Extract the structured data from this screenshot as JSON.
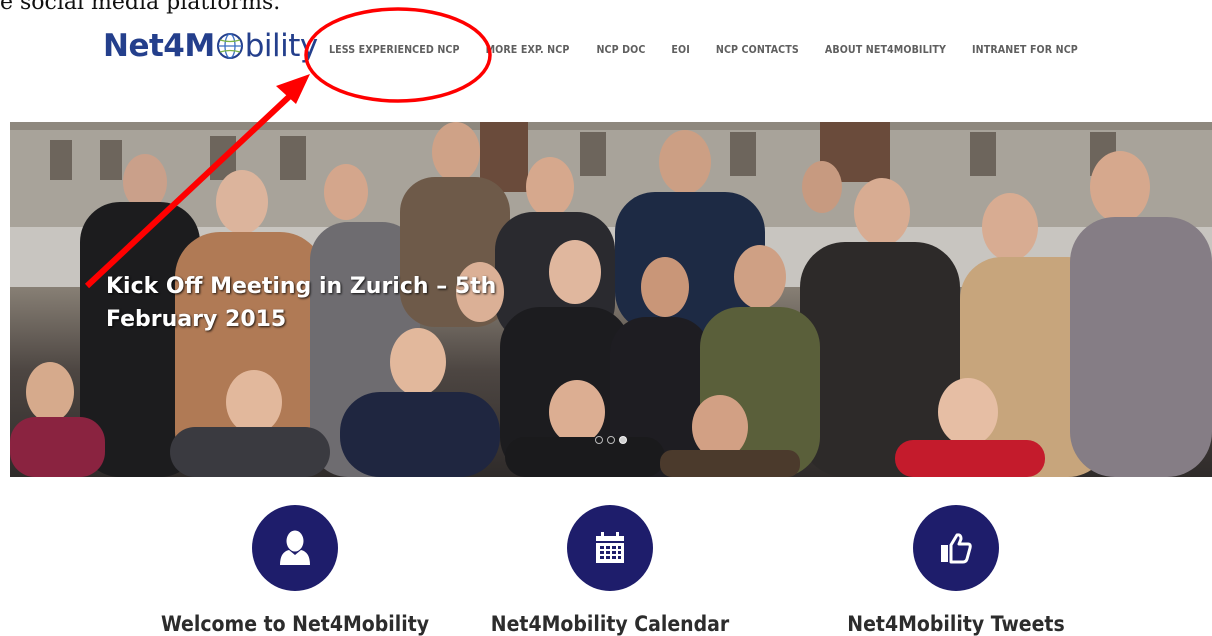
{
  "top_caption": "e social media platforms.",
  "logo": {
    "part1": "Net4M",
    "part2": "bility"
  },
  "nav": [
    "LESS EXPERIENCED NCP",
    "MORE EXP. NCP",
    "NCP DOC",
    "EOI",
    "NCP CONTACTS",
    "ABOUT NET4MOBILITY",
    "INTRANET FOR NCP"
  ],
  "hero": {
    "caption_line1": "Kick Off Meeting in Zurich – 5th",
    "caption_line2": "February 2015",
    "slide_dots": 3,
    "active_dot": 2
  },
  "features": [
    {
      "title": "Welcome to Net4Mobility",
      "icon": "user-icon"
    },
    {
      "title": "Net4Mobility Calendar",
      "icon": "calendar-icon"
    },
    {
      "title": "Net4Mobility Tweets",
      "icon": "thumbs-up-icon"
    }
  ],
  "colors": {
    "brand": "#243f8c",
    "icon_circle": "#1e1d6b",
    "nav_text": "#5f5f5f",
    "annotation": "#ff0000"
  }
}
